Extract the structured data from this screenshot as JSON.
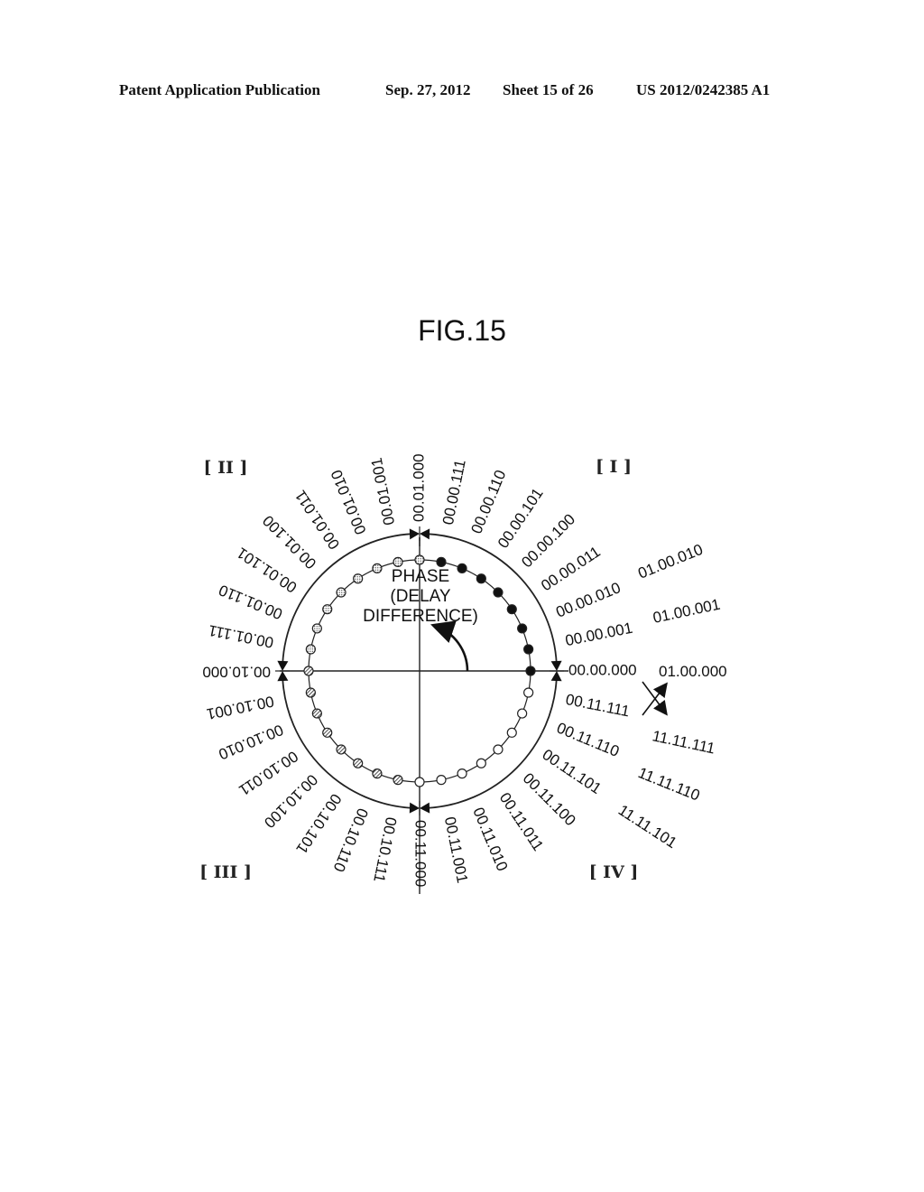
{
  "header": {
    "publication": "Patent Application Publication",
    "date": "Sep. 27, 2012",
    "sheet": "Sheet 15 of 26",
    "number": "US 2012/0242385 A1"
  },
  "figure": {
    "title": "FIG.15",
    "center_label": [
      "PHASE",
      "(DELAY",
      "DIFFERENCE)"
    ],
    "quadrants": [
      {
        "id": "I",
        "label": "[ I ]"
      },
      {
        "id": "II",
        "label": "[ II ]"
      },
      {
        "id": "III",
        "label": "[ III ]"
      },
      {
        "id": "IV",
        "label": "[ IV ]"
      }
    ],
    "inner_ring_labels": [
      "00.00.000",
      "00.00.001",
      "00.00.010",
      "00.00.011",
      "00.00.100",
      "00.00.101",
      "00.00.110",
      "00.00.111",
      "00.01.000",
      "00.01.001",
      "00.01.010",
      "00.01.011",
      "00.01.100",
      "00.01.101",
      "00.01.110",
      "00.01.111",
      "00.10.000",
      "00.10.001",
      "00.10.010",
      "00.10.011",
      "00.10.100",
      "00.10.101",
      "00.10.110",
      "00.10.111",
      "00.11.000",
      "00.11.001",
      "00.11.010",
      "00.11.011",
      "00.11.100",
      "00.11.101",
      "00.11.110",
      "00.11.111"
    ],
    "outer_labels_upper": [
      "01.00.000",
      "01.00.001",
      "01.00.010"
    ],
    "outer_labels_lower": [
      "11.11.111",
      "11.11.110",
      "11.11.101"
    ],
    "dot_styles": {
      "quadrant_I": "filled",
      "quadrant_II": "dotted",
      "quadrant_III": "hatched",
      "quadrant_IV": "open"
    }
  }
}
